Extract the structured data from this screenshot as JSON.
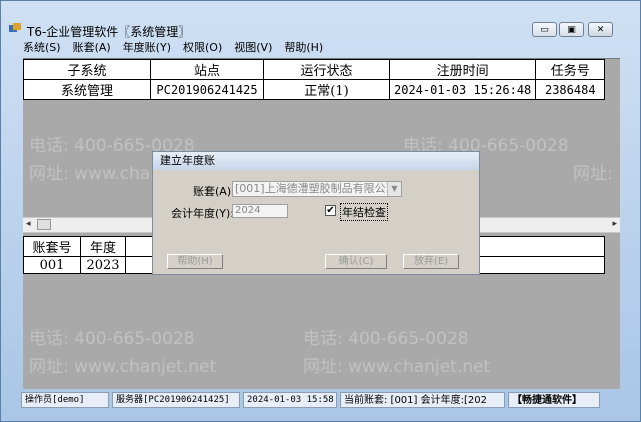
{
  "window": {
    "title": "T6-企业管理软件〖系统管理〗",
    "minimize_glyph": "▭",
    "restore_glyph": "▣",
    "close_glyph": "✕"
  },
  "menu": [
    "系统(S)",
    "账套(A)",
    "年度账(Y)",
    "权限(O)",
    "视图(V)",
    "帮助(H)"
  ],
  "process_table": {
    "columns": [
      "子系统",
      "站点",
      "运行状态",
      "注册时间",
      "任务号"
    ],
    "rows": [
      [
        "系统管理",
        "PC201906241425",
        "正常(1)",
        "2024-01-03 15:26:48",
        "2386484"
      ]
    ]
  },
  "account_table": {
    "columns": [
      "账套号",
      "年度"
    ],
    "rows": [
      [
        "001",
        "2023"
      ]
    ]
  },
  "scrollbar": {
    "left_arrow": "◂",
    "right_arrow": "▸"
  },
  "watermarks": {
    "phone": "电话: 400-665-0028",
    "site": "网址: www.chanjet.net",
    "phone_frag": "电话: 400-",
    "site_frag": "网址:"
  },
  "dialog": {
    "title": "建立年度账",
    "account_label": "账套(A):",
    "account_value": "[001]上海德澧塑胶制品有限公司",
    "dropdown_glyph": "▼",
    "year_label": "会计年度(Y):",
    "year_value": "2024",
    "check_mark": "✔",
    "check_label": "年结检查",
    "help_button": "帮助(H)",
    "confirm_button": "确认(C)",
    "cancel_button": "放弃(E)"
  },
  "statusbar": {
    "operator": "操作员[demo]",
    "server": "服务器[PC201906241425]",
    "datetime": "2024-01-03 15:58",
    "current_account": "当前账套: [001] 会计年度:[202",
    "brand": "【畅捷通软件】"
  },
  "colors": {
    "desktop": "#4a86c5",
    "client_bg": "#a9a9a9",
    "dialog_bg": "#d4d0c8"
  }
}
